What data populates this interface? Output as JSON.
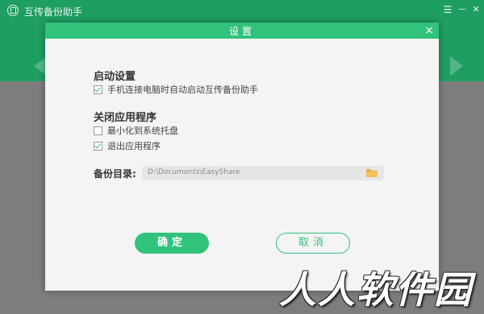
{
  "app": {
    "title": "互传备份助手"
  },
  "window_controls": {
    "menu": "☰",
    "minimize": "—",
    "close": "✕"
  },
  "dialog": {
    "title": "设置",
    "close_symbol": "×",
    "startup": {
      "heading": "启动设置",
      "options": [
        {
          "label": "手机连接电脑时自动启动互传备份助手",
          "checked": true
        }
      ]
    },
    "close_app": {
      "heading": "关闭应用程序",
      "options": [
        {
          "label": "最小化到系统托盘",
          "checked": false
        },
        {
          "label": "退出应用程序",
          "checked": true
        }
      ]
    },
    "backup_dir": {
      "label": "备份目录:",
      "value": "D:\\Documents\\EasyShare",
      "folder_icon": "folder-icon"
    },
    "buttons": {
      "ok": "确定",
      "cancel": "取消"
    }
  },
  "watermark": "人人软件园",
  "colors": {
    "accent": "#31c27c",
    "header": "#1e9e61",
    "overlay": "#808080"
  }
}
